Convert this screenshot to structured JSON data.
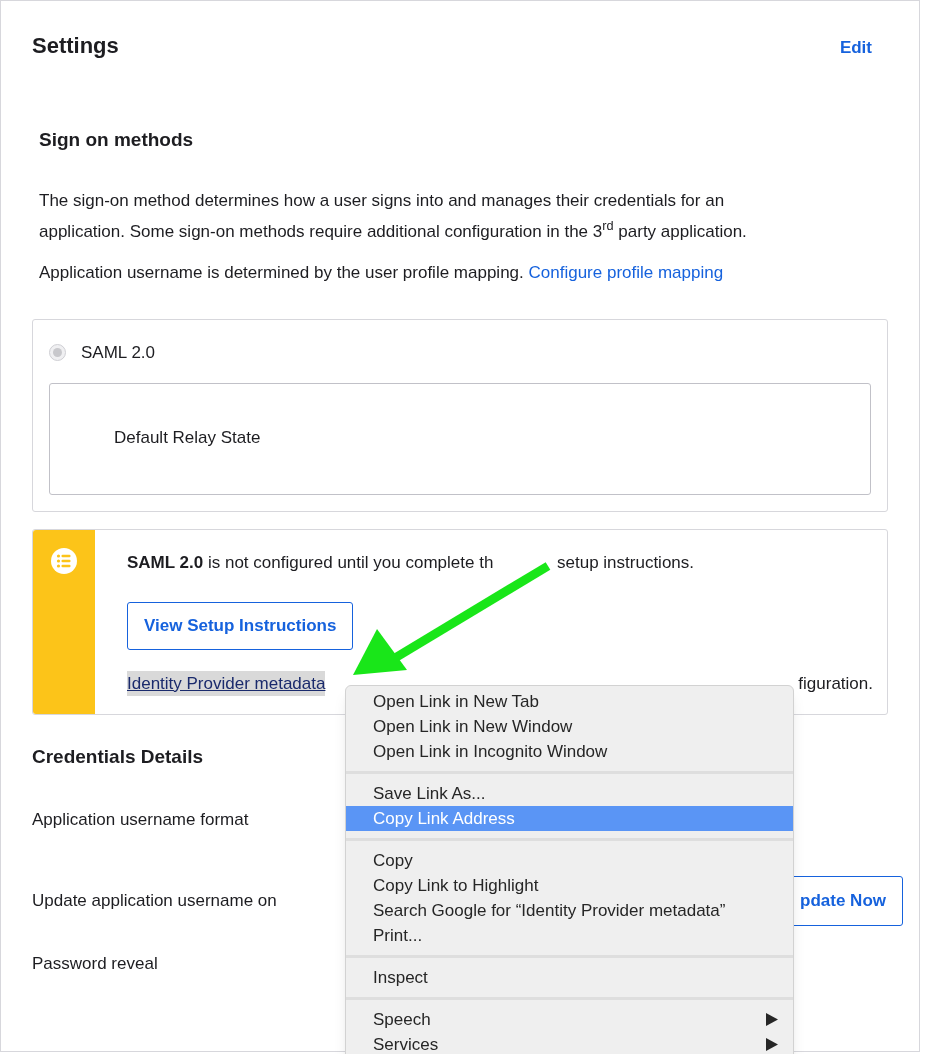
{
  "settings": {
    "title": "Settings",
    "edit": "Edit"
  },
  "sign_on": {
    "heading": "Sign on methods",
    "description": "The sign-on method determines how a user signs into and manages their credentials for an application. Some sign-on methods require additional configuration in the 3$^{rd}$ party application.",
    "mapping_text": "Application username is determined by the user profile mapping.",
    "mapping_link": "Configure profile mapping"
  },
  "saml": {
    "label": "SAML 2.0",
    "selected": true,
    "disabled": true,
    "field_label": "Default Relay State"
  },
  "notice": {
    "message": "**SAML 2.0** is not configured until you complete th",
    "message_end": "setup instructions.",
    "button": "View Setup Instructions",
    "link": "Identity Provider metadata",
    "link_highlighted": true,
    "tail": "figuration."
  },
  "credentials": {
    "heading": "Credentials Details",
    "rows": [
      {
        "label": "Application username format"
      },
      {
        "label": "Update application username on",
        "button": "pdate Now"
      },
      {
        "label": "Password reveal"
      }
    ]
  },
  "context_menu": {
    "groups": [
      [
        {
          "label": "Open Link in New Tab",
          "selected": false,
          "submenu": false
        },
        {
          "label": "Open Link in New Window",
          "selected": false,
          "submenu": false
        },
        {
          "label": "Open Link in Incognito Window",
          "selected": false,
          "submenu": false
        }
      ],
      [
        {
          "label": "Save Link As...",
          "selected": false,
          "submenu": false
        },
        {
          "label": "Copy Link Address",
          "selected": true,
          "submenu": false
        }
      ],
      [
        {
          "label": "Copy",
          "selected": false,
          "submenu": false
        },
        {
          "label": "Copy Link to Highlight",
          "selected": false,
          "submenu": false
        },
        {
          "label": "Search Google for “Identity Provider metadata”",
          "selected": false,
          "submenu": false
        },
        {
          "label": "Print...",
          "selected": false,
          "submenu": false
        }
      ],
      [
        {
          "label": "Inspect",
          "selected": false,
          "submenu": false
        }
      ],
      [
        {
          "label": "Speech",
          "selected": false,
          "submenu": true
        },
        {
          "label": "Services",
          "selected": false,
          "submenu": true
        }
      ]
    ]
  }
}
